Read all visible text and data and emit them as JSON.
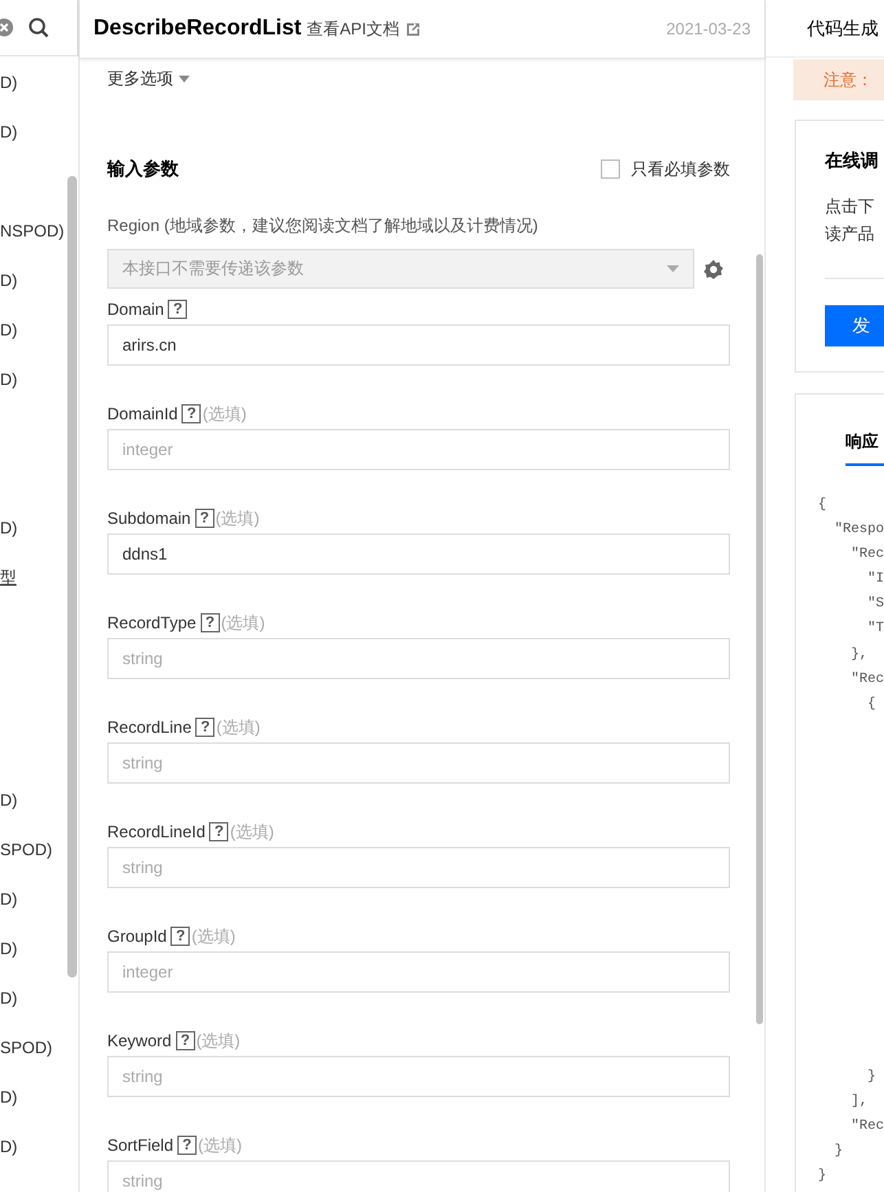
{
  "sidebar": {
    "groups": [
      {
        "items": [
          {
            "text": "D)",
            "link": false
          },
          {
            "text": "D)",
            "link": false
          }
        ]
      },
      {
        "items": [
          {
            "text": "NSPOD)",
            "link": false
          },
          {
            "text": "D)",
            "link": false
          },
          {
            "text": "D)",
            "link": false
          },
          {
            "text": "D)",
            "link": false
          }
        ]
      },
      {
        "items": [
          {
            "text": "D)",
            "link": false
          },
          {
            "text": "型",
            "link": true
          }
        ]
      },
      {
        "items": [
          {
            "text": "D)",
            "link": false
          },
          {
            "text": "SPOD)",
            "link": false
          },
          {
            "text": "D)",
            "link": false
          },
          {
            "text": "D)",
            "link": false
          },
          {
            "text": "D)",
            "link": false
          },
          {
            "text": "SPOD)",
            "link": false
          },
          {
            "text": "D)",
            "link": false
          },
          {
            "text": "D)",
            "link": false
          }
        ]
      }
    ]
  },
  "header": {
    "title": "DescribeRecordList",
    "doc_link": "查看API文档",
    "date": "2021-03-23"
  },
  "more_options": "更多选项",
  "params": {
    "title": "输入参数",
    "required_only": {
      "label": "只看必填参数",
      "checked": false
    },
    "region": {
      "label": "Region (地域参数，建议您阅读文档了解地域以及计费情况)",
      "placeholder": "本接口不需要传递该参数",
      "disabled": true
    },
    "fields": [
      {
        "name": "Domain",
        "help": "?",
        "value": "arirs.cn"
      },
      {
        "name": "DomainId",
        "help": "?",
        "optional": true,
        "optional_text": "(选填)",
        "placeholder": "integer"
      },
      {
        "name": "Subdomain",
        "help": "?",
        "optional": true,
        "optional_text": "(选填)",
        "value": "ddns1"
      },
      {
        "name": "RecordType",
        "help": "?",
        "optional": true,
        "optional_text": "(选填)",
        "placeholder": "string"
      },
      {
        "name": "RecordLine",
        "help": "?",
        "optional": true,
        "optional_text": "(选填)",
        "placeholder": "string"
      },
      {
        "name": "RecordLineId",
        "help": "?",
        "optional": true,
        "optional_text": "(选填)",
        "placeholder": "string"
      },
      {
        "name": "GroupId",
        "help": "?",
        "optional": true,
        "optional_text": "(选填)",
        "placeholder": "integer"
      },
      {
        "name": "Keyword",
        "help": "?",
        "optional": true,
        "optional_text": "(选填)",
        "placeholder": "string"
      },
      {
        "name": "SortField",
        "help": "?",
        "optional": true,
        "optional_text": "(选填)",
        "placeholder": "string"
      }
    ]
  },
  "right": {
    "title": "代码生成",
    "notice": "注意：",
    "debug": {
      "title": "在线调",
      "lines": [
        "点击下",
        "读产品"
      ],
      "send": "发"
    },
    "response": {
      "tab": "响应",
      "code_top": [
        "{",
        "  \"Respo",
        "    \"Rec",
        "      \"I",
        "      \"S",
        "      \"T",
        "    },",
        "    \"Rec",
        "      {"
      ],
      "code_bottom": [
        "      }",
        "    ],",
        "    \"Rec",
        "  }",
        "}"
      ]
    }
  }
}
